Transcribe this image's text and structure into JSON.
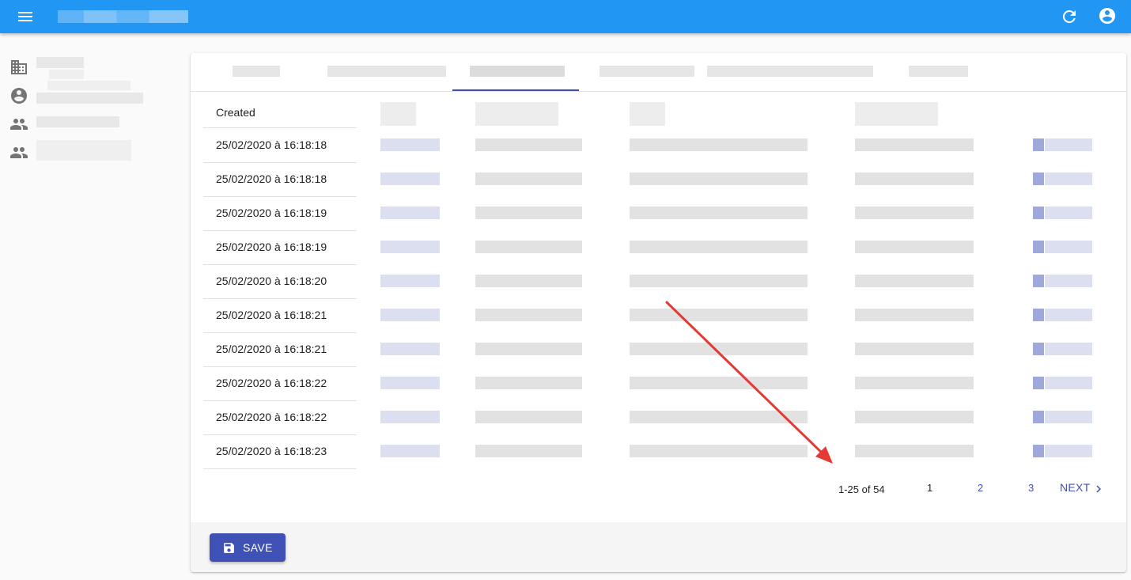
{
  "appbar": {
    "menu_icon": "menu-icon",
    "refresh_icon": "refresh-icon",
    "account_icon": "account-circle-icon",
    "color": "#2196f3"
  },
  "sidebar": {
    "items": [
      {
        "icon": "domain-icon"
      },
      {
        "icon": "account-circle-icon"
      },
      {
        "icon": "people-icon"
      },
      {
        "icon": "people-icon"
      }
    ]
  },
  "table": {
    "header_created": "Created",
    "rows": [
      "25/02/2020 à 16:18:18",
      "25/02/2020 à 16:18:18",
      "25/02/2020 à 16:18:19",
      "25/02/2020 à 16:18:19",
      "25/02/2020 à 16:18:20",
      "25/02/2020 à 16:18:21",
      "25/02/2020 à 16:18:21",
      "25/02/2020 à 16:18:22",
      "25/02/2020 à 16:18:22",
      "25/02/2020 à 16:18:23"
    ]
  },
  "pagination": {
    "range": "1-25 of 54",
    "pages": [
      "1",
      "2",
      "3"
    ],
    "current": "1",
    "next_label": "NEXT"
  },
  "toolbar": {
    "save_label": "SAVE"
  },
  "colors": {
    "primary": "#3f51b5",
    "appbar": "#2196f3",
    "annotation_arrow": "#e53935"
  }
}
